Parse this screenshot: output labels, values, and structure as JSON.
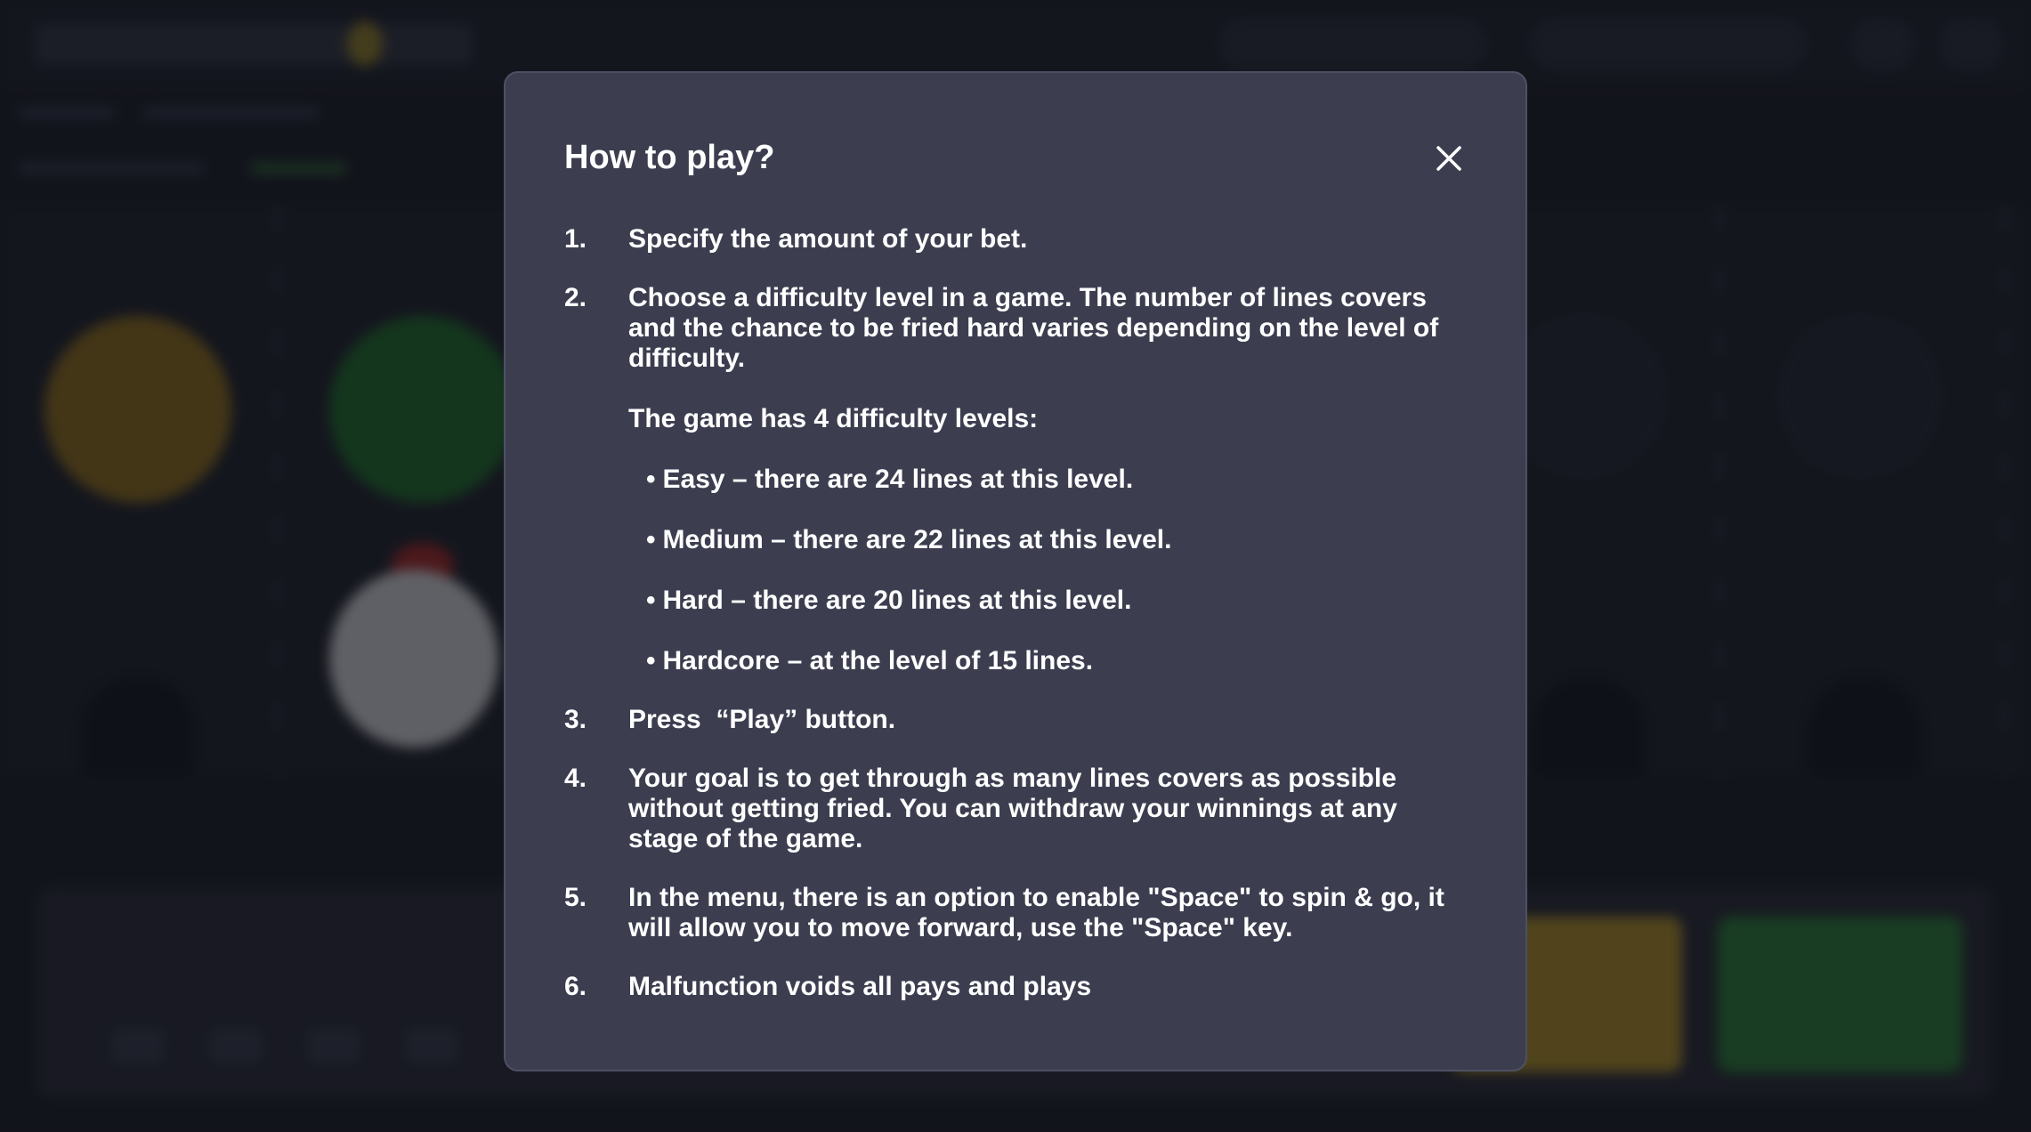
{
  "modal": {
    "title": "How to play?",
    "close_icon": "close-icon",
    "steps": [
      {
        "num": "1.",
        "text": "Specify the amount of your bet."
      },
      {
        "num": "2.",
        "text": "Choose a difficulty level in a game. The number of lines covers and the chance to be fried hard varies depending on the level of difficulty."
      },
      {
        "num": "3.",
        "text": "Press  “Play” button."
      },
      {
        "num": "4.",
        "text": "Your goal is to get through as many lines covers as possible without getting fried. You can withdraw your winnings at any stage of the game."
      },
      {
        "num": "5.",
        "text": "In the menu, there is an option to enable \"Space\" to spin & go, it will allow you to move forward, use the \"Space\" key."
      },
      {
        "num": "6.",
        "text": "Malfunction voids all pays and plays"
      }
    ],
    "levels_intro": "The game has 4 difficulty levels:",
    "bullet": "•",
    "levels": [
      "Easy – there are 24 lines at this level.",
      "Medium – there are 22 lines at this level.",
      "Hard – there are 20 lines at this level.",
      "Hardcore – at the level of 15 lines."
    ]
  },
  "colors": {
    "page_bg": "#1e2029",
    "modal_bg": "#3c3e50",
    "text": "#ffffff",
    "coin_gold": "#8a6a20",
    "coin_green": "#236b2e",
    "play_button": "#2d7a3a",
    "cashout_button": "#a88a2c"
  }
}
